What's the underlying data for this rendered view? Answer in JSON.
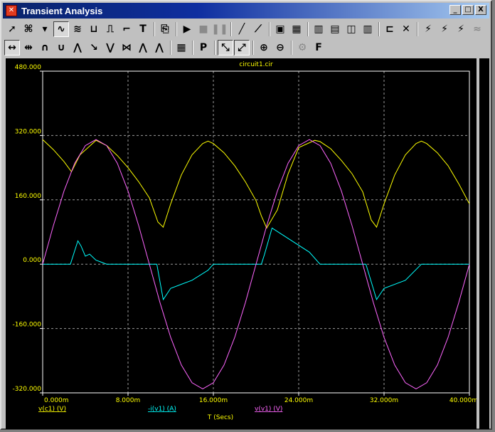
{
  "window": {
    "title": "Transient Analysis",
    "icon": "app-logo-icon",
    "btn_min": "_",
    "btn_max": "□",
    "btn_close": "X"
  },
  "toolbar1": [
    {
      "name": "select-tool",
      "icon": "arrow-cursor-icon",
      "glyph": "➚"
    },
    {
      "name": "curve-select-tool",
      "icon": "curve-select-icon",
      "glyph": "⌘"
    },
    {
      "name": "dropdown-tool",
      "icon": "chevron-down-icon",
      "glyph": "▾"
    },
    {
      "name": "linear-scale-tool",
      "icon": "waveform-icon",
      "glyph": "∿",
      "on": true
    },
    {
      "name": "log-scale-tool",
      "icon": "waveform-grid-icon",
      "glyph": "≋"
    },
    {
      "name": "axis-x-tool",
      "icon": "axis-icon",
      "glyph": "⊔"
    },
    {
      "name": "step-tool",
      "icon": "step-icon",
      "glyph": "⎍"
    },
    {
      "name": "label-tool",
      "icon": "curve-label-icon",
      "glyph": "⌐"
    },
    {
      "name": "text-tool",
      "icon": "text-icon",
      "glyph": "T"
    },
    {
      "sep": true
    },
    {
      "name": "copy-tool",
      "icon": "copy-icon",
      "glyph": "⎘"
    },
    {
      "sep": true
    },
    {
      "name": "run-button",
      "icon": "play-icon",
      "glyph": "▶"
    },
    {
      "name": "stop-button",
      "icon": "stop-icon",
      "glyph": "■",
      "dim": true
    },
    {
      "name": "pause-button",
      "icon": "pause-icon",
      "glyph": "❚❚",
      "dim": true
    },
    {
      "sep": true
    },
    {
      "name": "line-tool",
      "icon": "line-icon",
      "glyph": "╱"
    },
    {
      "name": "point-line-tool",
      "icon": "point-line-icon",
      "glyph": "⟋"
    },
    {
      "sep": true
    },
    {
      "name": "frame-tool",
      "icon": "frame-icon",
      "glyph": "▣"
    },
    {
      "name": "grid-tool",
      "icon": "grid-icon",
      "glyph": "▦"
    },
    {
      "sep": true
    },
    {
      "name": "vgrid-tool",
      "icon": "vertical-grid-icon",
      "glyph": "▥"
    },
    {
      "name": "hgrid-tool",
      "icon": "horizontal-grid-icon",
      "glyph": "▤"
    },
    {
      "name": "split-tool",
      "icon": "split-grid-icon",
      "glyph": "◫"
    },
    {
      "name": "columns-tool",
      "icon": "columns-icon",
      "glyph": "▥"
    },
    {
      "sep": true
    },
    {
      "name": "scope-tool",
      "icon": "scope-icon",
      "glyph": "⊏"
    },
    {
      "name": "cross-tool",
      "icon": "cross-icon",
      "glyph": "✕"
    },
    {
      "sep": true
    },
    {
      "name": "peak-tool",
      "icon": "peak-icon",
      "glyph": "⚡"
    },
    {
      "name": "valley-tool",
      "icon": "valley-icon",
      "glyph": "⚡"
    },
    {
      "name": "slope-tool",
      "icon": "slope-icon",
      "glyph": "⚡"
    },
    {
      "name": "wave-tool",
      "icon": "wave-icon",
      "glyph": "≈",
      "dim": true
    }
  ],
  "toolbar2": [
    {
      "name": "cursor-h-tool",
      "icon": "horizontal-cursor-icon",
      "glyph": "↔",
      "on": true
    },
    {
      "name": "cursor-v-tool",
      "icon": "vertical-cursor-icon",
      "glyph": "⇹"
    },
    {
      "name": "peak-max-tool",
      "icon": "peak-max-icon",
      "glyph": "∩"
    },
    {
      "name": "peak-min-tool",
      "icon": "peak-min-icon",
      "glyph": "∪"
    },
    {
      "name": "local-max-tool",
      "icon": "local-max-icon",
      "glyph": "⋀"
    },
    {
      "name": "slope-down-tool",
      "icon": "slope-down-icon",
      "glyph": "↘"
    },
    {
      "name": "local-min-tool",
      "icon": "local-min-icon",
      "glyph": "⋁"
    },
    {
      "name": "inflection-tool",
      "icon": "inflection-icon",
      "glyph": "⋈"
    },
    {
      "name": "average-tool",
      "icon": "average-icon",
      "glyph": "⋀"
    },
    {
      "name": "global-max-tool",
      "icon": "global-max-icon",
      "glyph": "⋀"
    },
    {
      "sep": true
    },
    {
      "name": "table-tool",
      "icon": "table-icon",
      "glyph": "▦"
    },
    {
      "sep": true
    },
    {
      "name": "performance-tool",
      "icon": "performance-icon",
      "glyph": "P"
    },
    {
      "sep": true
    },
    {
      "name": "scale-x-tool",
      "icon": "scale-x-icon",
      "glyph": "⤡",
      "on": true
    },
    {
      "name": "scale-y-tool",
      "icon": "scale-y-icon",
      "glyph": "⤢",
      "on": true
    },
    {
      "sep": true
    },
    {
      "name": "zoom-in-tool",
      "icon": "zoom-in-icon",
      "glyph": "⊕"
    },
    {
      "name": "zoom-out-tool",
      "icon": "zoom-out-icon",
      "glyph": "⊖"
    },
    {
      "sep": true
    },
    {
      "name": "settings-tool",
      "icon": "gear-icon",
      "glyph": "⚙",
      "dim": true
    },
    {
      "name": "font-tool",
      "icon": "font-icon",
      "glyph": "F"
    }
  ],
  "chart_data": {
    "type": "line",
    "title": "circuit1.cir",
    "xlabel": "T (Secs)",
    "xlim": [
      0,
      0.04
    ],
    "ylim": [
      -320,
      480
    ],
    "grid": true,
    "x_ticks": [
      0,
      0.008,
      0.016,
      0.024,
      0.032,
      0.04
    ],
    "x_tick_labels": [
      "0.000m",
      "8.000m",
      "16.000m",
      "24.000m",
      "32.000m",
      "40.000m"
    ],
    "y_ticks": [
      -320,
      -160,
      0,
      160,
      320,
      480
    ],
    "y_tick_labels": [
      "-320.000",
      "-160.000",
      "0.000",
      "160.000",
      "320.000",
      "480.000"
    ],
    "series": [
      {
        "name": "v(c1) (V)",
        "color": "#ffff00",
        "x": [
          0,
          0.001,
          0.002,
          0.0027,
          0.0035,
          0.005,
          0.006,
          0.007,
          0.008,
          0.009,
          0.01,
          0.0108,
          0.0113,
          0.012,
          0.013,
          0.014,
          0.015,
          0.0155,
          0.016,
          0.017,
          0.018,
          0.019,
          0.02,
          0.0205,
          0.021,
          0.022,
          0.023,
          0.024,
          0.0255,
          0.026,
          0.027,
          0.028,
          0.029,
          0.03,
          0.0308,
          0.0313,
          0.032,
          0.033,
          0.034,
          0.035,
          0.0355,
          0.036,
          0.037,
          0.038,
          0.039,
          0.04
        ],
        "y": [
          310,
          285,
          255,
          230,
          272,
          308,
          295,
          270,
          240,
          205,
          165,
          105,
          92,
          150,
          222,
          272,
          300,
          306,
          300,
          277,
          245,
          205,
          158,
          120,
          90,
          135,
          224,
          290,
          308,
          305,
          287,
          258,
          225,
          180,
          110,
          92,
          150,
          222,
          272,
          300,
          306,
          300,
          277,
          245,
          200,
          150
        ]
      },
      {
        "name": "-i(v1) (A)",
        "color": "#00ffff",
        "x": [
          0,
          0.0026,
          0.0033,
          0.0036,
          0.004,
          0.0044,
          0.005,
          0.0055,
          0.006,
          0.0065,
          0.0107,
          0.0113,
          0.012,
          0.014,
          0.0155,
          0.016,
          0.0205,
          0.0208,
          0.0215,
          0.025,
          0.026,
          0.0303,
          0.0313,
          0.032,
          0.034,
          0.0355,
          0.04
        ],
        "y": [
          0,
          0,
          58,
          45,
          20,
          25,
          10,
          5,
          0,
          0,
          0,
          -88,
          -60,
          -40,
          -15,
          0,
          0,
          25,
          90,
          30,
          0,
          0,
          -88,
          -60,
          -40,
          0,
          0
        ]
      },
      {
        "name": "v(v1) (V)",
        "color": "#ff66ff",
        "function": "310*sin(2*pi*50*t)",
        "x": [
          0,
          0.001,
          0.002,
          0.003,
          0.004,
          0.005,
          0.006,
          0.007,
          0.008,
          0.009,
          0.01,
          0.011,
          0.012,
          0.013,
          0.014,
          0.015,
          0.016,
          0.017,
          0.018,
          0.019,
          0.02,
          0.021,
          0.022,
          0.023,
          0.024,
          0.025,
          0.026,
          0.027,
          0.028,
          0.029,
          0.03,
          0.031,
          0.032,
          0.033,
          0.034,
          0.035,
          0.036,
          0.037,
          0.038,
          0.039,
          0.04
        ],
        "y": [
          0,
          95.8,
          182.2,
          250.8,
          294.8,
          310,
          294.8,
          250.8,
          182.2,
          95.8,
          0,
          -95.8,
          -182.2,
          -250.8,
          -294.8,
          -310,
          -294.8,
          -250.8,
          -182.2,
          -95.8,
          0,
          95.8,
          182.2,
          250.8,
          294.8,
          310,
          294.8,
          250.8,
          182.2,
          95.8,
          0,
          -95.8,
          -182.2,
          -250.8,
          -294.8,
          -310,
          -294.8,
          -250.8,
          -182.2,
          -95.8,
          0
        ]
      }
    ],
    "axis_color": "#ffffff",
    "tick_label_color": "#ffff00",
    "legend": "bottom"
  }
}
